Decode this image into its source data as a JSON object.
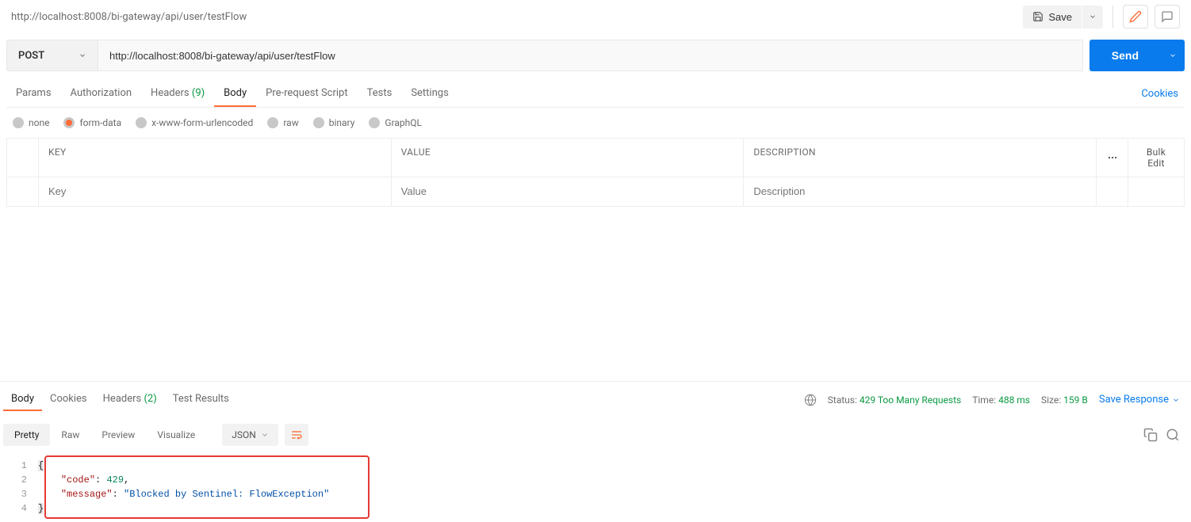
{
  "header": {
    "title": "http://localhost:8008/bi-gateway/api/user/testFlow",
    "save": "Save"
  },
  "request": {
    "method": "POST",
    "url": "http://localhost:8008/bi-gateway/api/user/testFlow",
    "send": "Send"
  },
  "tabs": {
    "params": "Params",
    "auth": "Authorization",
    "headers": "Headers",
    "headersCount": "(9)",
    "body": "Body",
    "prereq": "Pre-request Script",
    "tests": "Tests",
    "settings": "Settings",
    "cookies": "Cookies"
  },
  "bodyTypes": {
    "none": "none",
    "formdata": "form-data",
    "urlenc": "x-www-form-urlencoded",
    "raw": "raw",
    "binary": "binary",
    "graphql": "GraphQL"
  },
  "kv": {
    "key": "KEY",
    "value": "VALUE",
    "desc": "DESCRIPTION",
    "bulk": "Bulk Edit",
    "keyPh": "Key",
    "valuePh": "Value",
    "descPh": "Description"
  },
  "responseTabs": {
    "body": "Body",
    "cookies": "Cookies",
    "headers": "Headers",
    "headersCount": "(2)",
    "testResults": "Test Results"
  },
  "responseMeta": {
    "statusLabel": "Status:",
    "status": "429 Too Many Requests",
    "timeLabel": "Time:",
    "time": "488 ms",
    "sizeLabel": "Size:",
    "size": "159 B",
    "saveResponse": "Save Response"
  },
  "viewControls": {
    "pretty": "Pretty",
    "raw": "Raw",
    "preview": "Preview",
    "visualize": "Visualize",
    "format": "JSON"
  },
  "responseBody": {
    "code": 429,
    "message": "Blocked by Sentinel: FlowException"
  }
}
